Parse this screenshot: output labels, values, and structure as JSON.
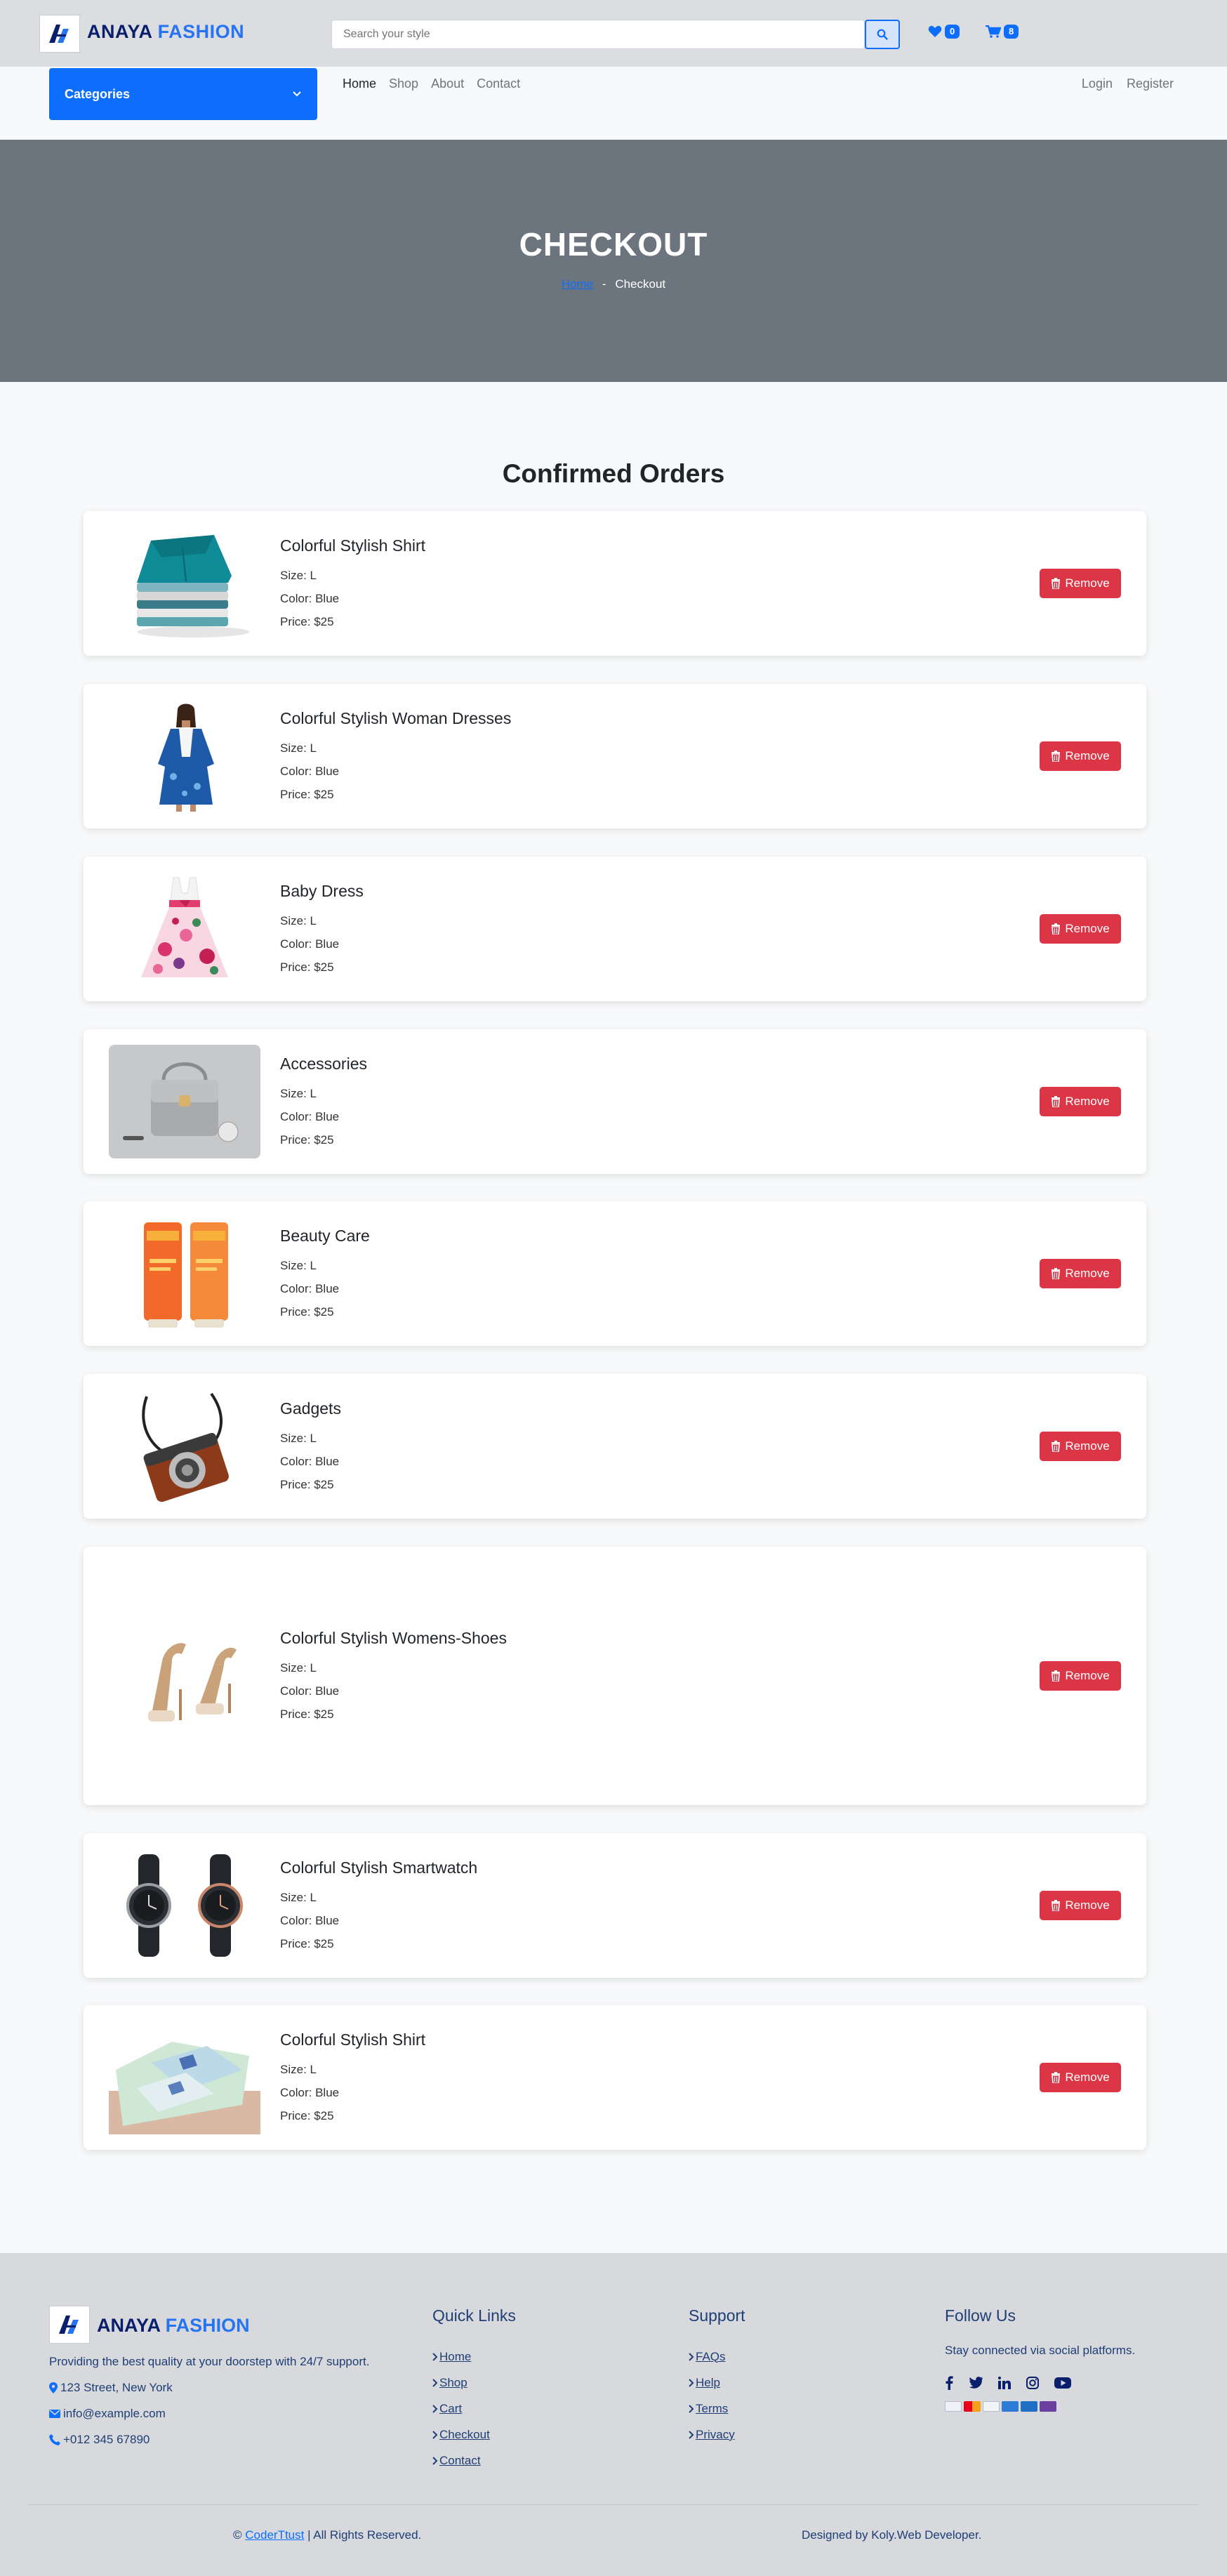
{
  "header": {
    "brand_main": "ANAYA",
    "brand_accent": "FASHION",
    "search_placeholder": "Search your style",
    "wishlist_count": "0",
    "cart_count": "8"
  },
  "nav": {
    "categories_label": "Categories",
    "links": [
      "Home",
      "Shop",
      "About",
      "Contact"
    ],
    "login": "Login",
    "register": "Register"
  },
  "hero": {
    "title": "CHECKOUT",
    "crumb_home": "Home",
    "crumb_sep": "-",
    "crumb_current": "Checkout"
  },
  "orders": {
    "title": "Confirmed Orders",
    "remove_label": "Remove",
    "size_prefix": "Size: ",
    "color_prefix": "Color: ",
    "price_prefix": "Price: ",
    "items": [
      {
        "name": "Colorful Stylish Shirt",
        "size": "L",
        "color": "Blue",
        "price": "$25",
        "icon": "folded-shirts"
      },
      {
        "name": "Colorful Stylish Woman Dresses",
        "size": "L",
        "color": "Blue",
        "price": "$25",
        "icon": "woman-dress"
      },
      {
        "name": "Baby Dress",
        "size": "L",
        "color": "Blue",
        "price": "$25",
        "icon": "baby-dress"
      },
      {
        "name": "Accessories",
        "size": "L",
        "color": "Blue",
        "price": "$25",
        "icon": "handbag"
      },
      {
        "name": "Beauty Care",
        "size": "L",
        "color": "Blue",
        "price": "$25",
        "icon": "cosmetic-tubes"
      },
      {
        "name": "Gadgets",
        "size": "L",
        "color": "Blue",
        "price": "$25",
        "icon": "camera"
      },
      {
        "name": "Colorful Stylish Womens-Shoes",
        "size": "L",
        "color": "Blue",
        "price": "$25",
        "icon": "heels"
      },
      {
        "name": "Colorful Stylish Smartwatch",
        "size": "L",
        "color": "Blue",
        "price": "$25",
        "icon": "watches"
      },
      {
        "name": "Colorful Stylish Shirt",
        "size": "L",
        "color": "Blue",
        "price": "$25",
        "icon": "shirts"
      }
    ]
  },
  "footer": {
    "brand_main": "ANAYA",
    "brand_accent": "FASHION",
    "tagline": "Providing the best quality at your doorstep with 24/7 support.",
    "address": "123 Street, New York",
    "email": "info@example.com",
    "phone": "+012 345 67890",
    "quick_links_title": "Quick Links",
    "quick_links": [
      "Home",
      "Shop",
      "Cart",
      "Checkout",
      "Contact"
    ],
    "support_title": "Support",
    "support_links": [
      "FAQs",
      "Help",
      "Terms",
      "Privacy"
    ],
    "follow_title": "Follow Us",
    "follow_text": "Stay connected via social platforms.",
    "socials": [
      "facebook-icon",
      "twitter-icon",
      "linkedin-icon",
      "instagram-icon",
      "youtube-icon"
    ],
    "copyright_symbol": "©",
    "copyright_link": "CoderTtust",
    "copyright_rest": "| All Rights Reserved.",
    "designed_by": "Designed by Koly.Web Developer."
  },
  "colors": {
    "primary": "#0d6efd",
    "danger": "#dc3545",
    "hero_bg": "#6c757d",
    "brand_dark": "#0a1f6b",
    "footer_text": "#1f3e76"
  }
}
